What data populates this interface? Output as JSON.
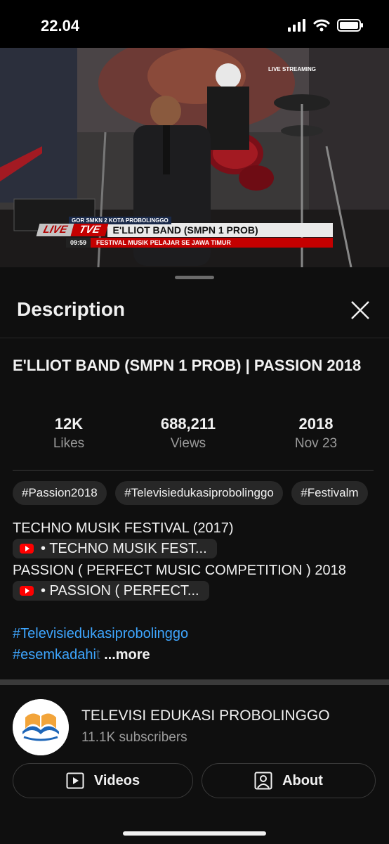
{
  "status_bar": {
    "time": "22.04"
  },
  "video": {
    "venue": "GOR SMKN 2 KOTA PROBOLINGGO",
    "live_tag": "LIVE",
    "channel_tag": "TVE",
    "band_caption": "E'LLIOT BAND (SMPN 1 PROB)",
    "clock": "09:59",
    "festival_caption": "FESTIVAL MUSIK PELAJAR SE JAWA TIMUR",
    "livestream_tag": "LIVE STREAMING"
  },
  "description_panel": {
    "title": "Description",
    "video_title": "E'LLIOT BAND (SMPN 1 PROB) | PASSION 2018",
    "stats": {
      "likes_value": "12K",
      "likes_label": "Likes",
      "views_value": "688,211",
      "views_label": "Views",
      "year_value": "2018",
      "date_label": "Nov 23"
    },
    "hashtag_chips": [
      "#Passion2018",
      "#Televisiedukasiprobolinggo",
      "#Festivalm"
    ],
    "description_lines": {
      "line1": "TECHNO MUSIK FESTIVAL (2017)",
      "pill1": "• TECHNO MUSIK FEST...",
      "line2": "PASSION ( PERFECT MUSIC COMPETITION ) 2018",
      "pill2": "• PASSION ( PERFECT...",
      "hashtag1": "#Televisiedukasiprobolinggo",
      "hashtag2_visible": "#esemkadahi",
      "hashtag2_faded": "t",
      "more": "...more"
    }
  },
  "channel": {
    "name": "TELEVISI EDUKASI PROBOLINGGO",
    "subscribers": "11.1K subscribers",
    "videos_button": "Videos",
    "about_button": "About"
  },
  "colors": {
    "background": "#0f0f0f",
    "link": "#3ea6ff",
    "youtube_red": "#ff0000"
  }
}
